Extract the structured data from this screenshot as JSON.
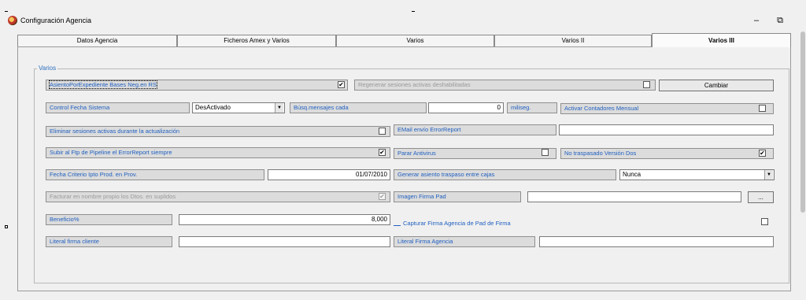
{
  "window": {
    "title": "Configuración Agencia",
    "minimize_glyph": "–",
    "restore_glyph": "⧉"
  },
  "tabs": [
    {
      "label": "Datos Agencia",
      "active": false
    },
    {
      "label": "Ficheros Amex y Varios",
      "active": false
    },
    {
      "label": "Varios",
      "active": false
    },
    {
      "label": "Varios II",
      "active": false
    },
    {
      "label": "Varios III",
      "active": true
    }
  ],
  "group": {
    "legend": "Varios"
  },
  "rows": {
    "asiento_label": "AsientoPorExpediente Bases Neg.en RS",
    "asiento_checked": "✔",
    "regenerar_label": "Regenerar sesiones activas deshabilitadas",
    "regenerar_checked": "",
    "cambiar_button": "Cambiar",
    "control_fecha_label": "Control Fecha Sistema",
    "control_fecha_value": "DesActivado",
    "busq_label": "Búsq.mensajes cada",
    "busq_value": "0",
    "busq_unit": "miliseg.",
    "contadores_label": "Activar Contadores Mensual",
    "contadores_checked": "",
    "eliminar_label": "Eliminar sesiones activas durante la actualización",
    "eliminar_checked": "",
    "email_label": "EMail envío ErrorReport",
    "email_value": "",
    "subir_label": "Subir al Ftp de Pipeline el ErrorReport siempre",
    "subir_checked": "✔",
    "parar_label": "Parar Antivirus",
    "parar_checked": "",
    "no_traspasado_label": "No traspasado Versión Dos",
    "no_traspasado_checked": "✔",
    "fecha_criterio_label": "Fecha Criterio Ipto Prod. en Prov.",
    "fecha_criterio_value": "01/07/2010",
    "generar_label": "Generar asiento traspaso entre cajas",
    "generar_value": "Nunca",
    "facturar_label": "Facturar en nombre propio los Dtos. en suplidos",
    "facturar_checked": "✔",
    "imagen_label": "Imagen Firma Pad",
    "imagen_value": "",
    "imagen_button": "...",
    "beneficio_label": "Beneficio%",
    "beneficio_value": "8,000",
    "capturar_label": "Capturar Firma Agencia de Pad de Firma",
    "capturar_checked": "",
    "literal_cliente_label": "Literal firma cliente",
    "literal_cliente_value": "",
    "literal_agencia_label": "Literal Firma Agencia",
    "literal_agencia_value": ""
  }
}
